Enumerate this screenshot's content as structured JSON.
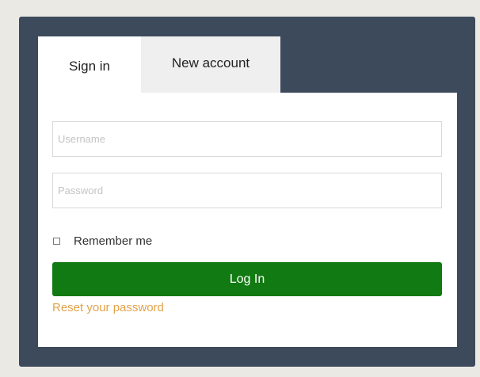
{
  "tabs": {
    "sign_in": "Sign in",
    "new_account": "New account"
  },
  "form": {
    "username_placeholder": "Username",
    "password_placeholder": "Password",
    "remember_label": "Remember me",
    "login_label": "Log In",
    "reset_label": "Reset your password"
  },
  "colors": {
    "page_bg": "#ebe9e4",
    "frame_bg": "#3d4a5c",
    "login_button": "#127a12",
    "link": "#e3a24a"
  }
}
